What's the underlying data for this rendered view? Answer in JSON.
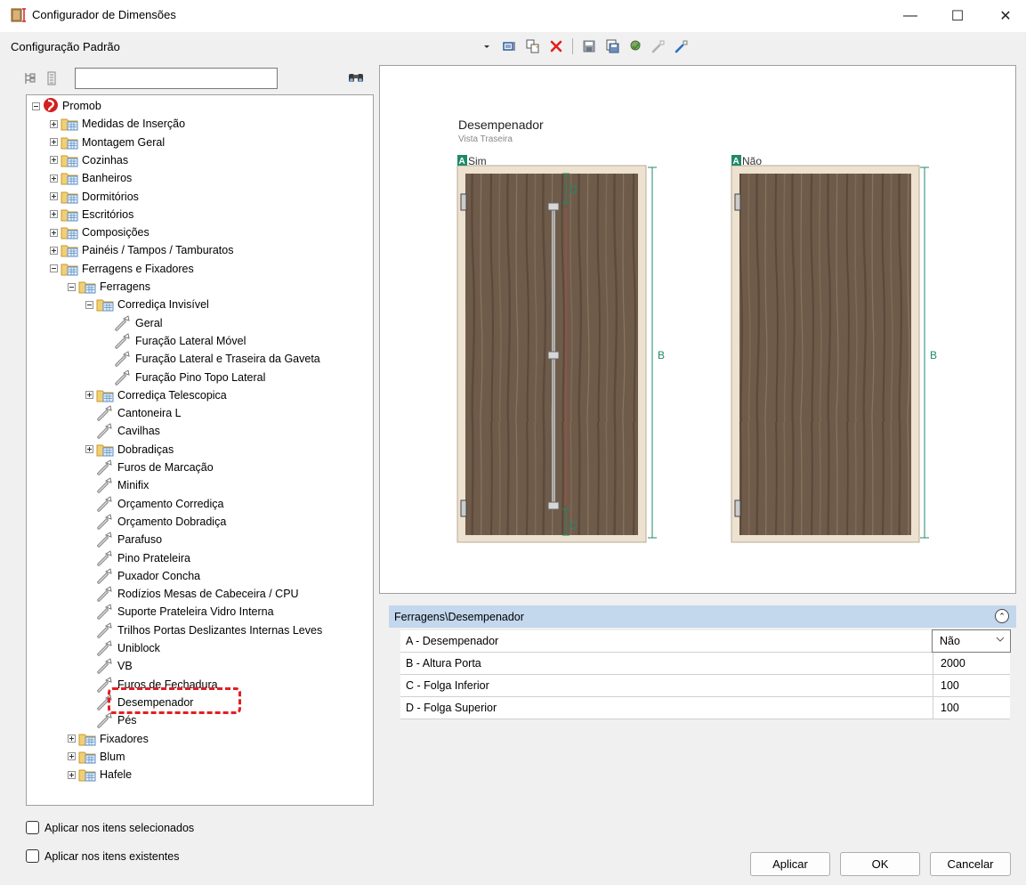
{
  "window": {
    "title": "Configurador de Dimensões",
    "minimize": "—",
    "maximize": "☐",
    "close": "✕"
  },
  "config": {
    "label": "Configuração Padrão"
  },
  "toolbar": {
    "icons": [
      "dropdown-arrow-icon",
      "show-dimensions-icon",
      "copy-icon",
      "delete-icon",
      "save-icon",
      "save-as-icon",
      "validate-icon",
      "import-icon",
      "export-icon"
    ]
  },
  "tree": {
    "search_value": "",
    "search_icon_glyph": "🔭",
    "items": [
      {
        "label": "Promob",
        "level": 0,
        "type": "root",
        "expander": "minus"
      },
      {
        "label": "Medidas de Inserção",
        "level": 1,
        "type": "folder",
        "expander": "plus"
      },
      {
        "label": "Montagem Geral",
        "level": 1,
        "type": "folder",
        "expander": "plus"
      },
      {
        "label": "Cozinhas",
        "level": 1,
        "type": "folder",
        "expander": "plus"
      },
      {
        "label": "Banheiros",
        "level": 1,
        "type": "folder",
        "expander": "plus"
      },
      {
        "label": "Dormitórios",
        "level": 1,
        "type": "folder",
        "expander": "plus"
      },
      {
        "label": "Escritórios",
        "level": 1,
        "type": "folder",
        "expander": "plus"
      },
      {
        "label": "Composições",
        "level": 1,
        "type": "folder",
        "expander": "plus"
      },
      {
        "label": "Painéis / Tampos / Tamburatos",
        "level": 1,
        "type": "folder",
        "expander": "plus"
      },
      {
        "label": "Ferragens e Fixadores",
        "level": 1,
        "type": "folder",
        "expander": "minus"
      },
      {
        "label": "Ferragens",
        "level": 2,
        "type": "folder",
        "expander": "minus"
      },
      {
        "label": "Corrediça Invisível",
        "level": 3,
        "type": "folder",
        "expander": "minus"
      },
      {
        "label": "Geral",
        "level": 4,
        "type": "param",
        "expander": ""
      },
      {
        "label": "Furação Lateral Móvel",
        "level": 4,
        "type": "param",
        "expander": ""
      },
      {
        "label": "Furação Lateral e Traseira da Gaveta",
        "level": 4,
        "type": "param",
        "expander": ""
      },
      {
        "label": "Furação Pino Topo Lateral",
        "level": 4,
        "type": "param",
        "expander": ""
      },
      {
        "label": "Corrediça Telescopica",
        "level": 3,
        "type": "folder",
        "expander": "plus"
      },
      {
        "label": "Cantoneira L",
        "level": 3,
        "type": "param",
        "expander": ""
      },
      {
        "label": "Cavilhas",
        "level": 3,
        "type": "param",
        "expander": ""
      },
      {
        "label": "Dobradiças",
        "level": 3,
        "type": "folder",
        "expander": "plus"
      },
      {
        "label": "Furos de Marcação",
        "level": 3,
        "type": "param",
        "expander": ""
      },
      {
        "label": "Minifix",
        "level": 3,
        "type": "param",
        "expander": ""
      },
      {
        "label": "Orçamento Corrediça",
        "level": 3,
        "type": "param",
        "expander": ""
      },
      {
        "label": "Orçamento Dobradiça",
        "level": 3,
        "type": "param",
        "expander": ""
      },
      {
        "label": "Parafuso",
        "level": 3,
        "type": "param",
        "expander": ""
      },
      {
        "label": "Pino Prateleira",
        "level": 3,
        "type": "param",
        "expander": ""
      },
      {
        "label": "Puxador Concha",
        "level": 3,
        "type": "param",
        "expander": ""
      },
      {
        "label": "Rodízios Mesas de Cabeceira / CPU",
        "level": 3,
        "type": "param",
        "expander": ""
      },
      {
        "label": "Suporte Prateleira Vidro Interna",
        "level": 3,
        "type": "param",
        "expander": ""
      },
      {
        "label": "Trilhos Portas Deslizantes Internas Leves",
        "level": 3,
        "type": "param",
        "expander": ""
      },
      {
        "label": "Uniblock",
        "level": 3,
        "type": "param",
        "expander": ""
      },
      {
        "label": "VB",
        "level": 3,
        "type": "param",
        "expander": ""
      },
      {
        "label": "Furos de Fechadura",
        "level": 3,
        "type": "param",
        "expander": ""
      },
      {
        "label": "Desempenador",
        "level": 3,
        "type": "param",
        "expander": "",
        "highlighted": true
      },
      {
        "label": "Pés",
        "level": 3,
        "type": "param",
        "expander": ""
      },
      {
        "label": "Fixadores",
        "level": 2,
        "type": "folder",
        "expander": "plus"
      },
      {
        "label": "Blum",
        "level": 2,
        "type": "folder",
        "expander": "plus"
      },
      {
        "label": "Hafele",
        "level": 2,
        "type": "folder",
        "expander": "plus"
      }
    ]
  },
  "checkboxes": {
    "selected_items": "Aplicar nos itens selecionados",
    "existing_items": "Aplicar nos itens existentes"
  },
  "preview": {
    "title": "Desempenador",
    "subtitle": "Vista Traseira",
    "badge_letter": "A",
    "left_door_label": "Sim",
    "right_door_label": "Não",
    "dim_b": "B",
    "dim_c": "C",
    "dim_d": "D"
  },
  "properties": {
    "header": "Ferragens\\Desempenador",
    "collapse_glyph": "⌃",
    "rows": [
      {
        "name": "A - Desempenador",
        "value": "Não",
        "dropdown": true
      },
      {
        "name": "B - Altura Porta",
        "value": "2000",
        "dropdown": false
      },
      {
        "name": "C - Folga Inferior",
        "value": "100",
        "dropdown": false
      },
      {
        "name": "D - Folga Superior",
        "value": "100",
        "dropdown": false
      }
    ]
  },
  "buttons": {
    "apply": "Aplicar",
    "ok": "OK",
    "cancel": "Cancelar"
  },
  "colors": {
    "accent_green": "#1f8a6a",
    "wood": "#6e5a49",
    "frame": "#e9dcc9",
    "highlight_red": "#e31e24",
    "grid_header": "#c3d7ed"
  }
}
